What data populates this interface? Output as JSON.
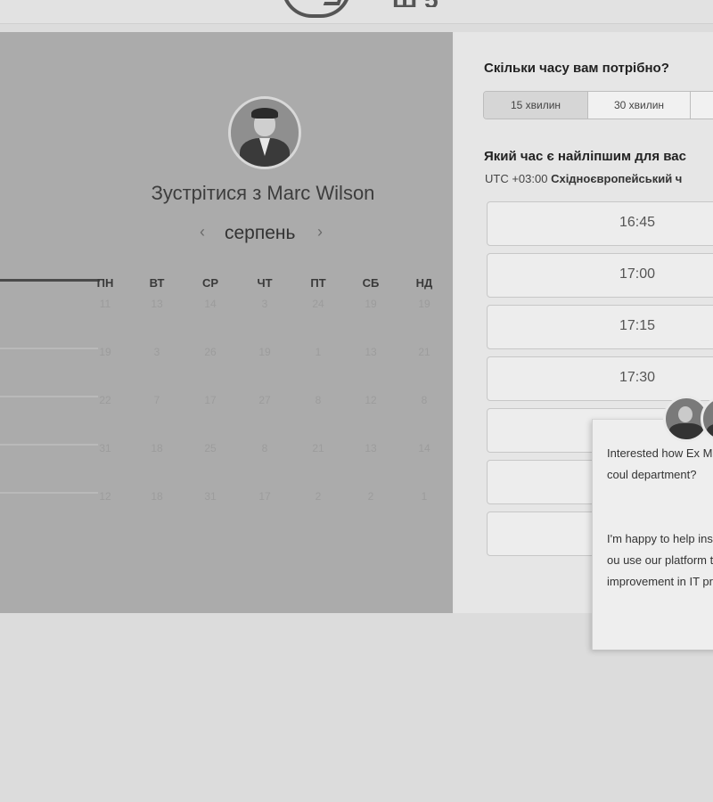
{
  "header": {
    "logo_text": "Ш5"
  },
  "left_panel": {
    "meet_label": "Зустрітися з",
    "person_name": "Marc Wilson",
    "month": "серпень",
    "prev_icon": "‹",
    "next_icon": "›",
    "weekdays": [
      "ПН",
      "ВТ",
      "СР",
      "ЧТ",
      "ПТ",
      "СБ",
      "НД"
    ],
    "weeks": [
      [
        "11",
        "13",
        "14",
        "3",
        "24",
        "19",
        "19"
      ],
      [
        "19",
        "3",
        "26",
        "19",
        "1",
        "13",
        "21"
      ],
      [
        "22",
        "7",
        "17",
        "27",
        "8",
        "12",
        "8"
      ],
      [
        "31",
        "18",
        "25",
        "8",
        "21",
        "13",
        "14"
      ],
      [
        "12",
        "18",
        "31",
        "17",
        "2",
        "2",
        "1"
      ]
    ]
  },
  "right_panel": {
    "duration_title": "Скільки часу вам потрібно?",
    "durations": [
      "15 хвилин",
      "30 хвилин",
      ""
    ],
    "time_title": "Який час є найліпшим для вас",
    "timezone_offset": "UTC +03:00",
    "timezone_name": "Східноєвропейський ч",
    "slots": [
      "16:45",
      "17:00",
      "17:15",
      "17:30",
      "",
      "",
      ""
    ]
  },
  "chat_popup": {
    "p1": "Interested how Ex Management coul department?",
    "p2": "I'm happy to help insight into how ou use our platform to improvement in IT productivity."
  }
}
